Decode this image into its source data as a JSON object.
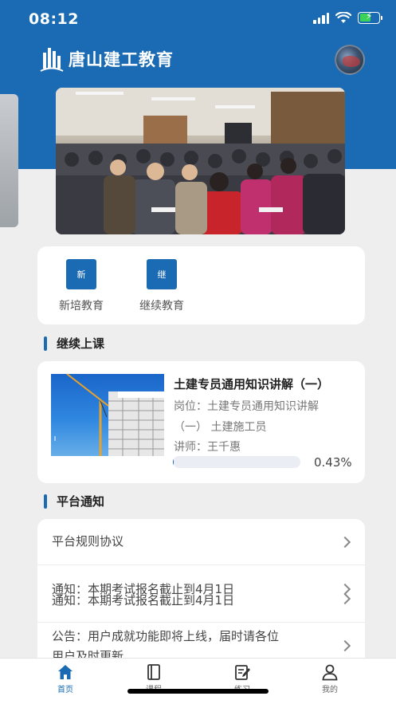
{
  "status_bar": {
    "time": "08:12"
  },
  "header": {
    "logo_text": "唐山建工教育"
  },
  "quick_menu": [
    {
      "icon_text": "新",
      "label": "新培教育"
    },
    {
      "icon_text": "继",
      "label": "继续教育"
    }
  ],
  "sections": {
    "continue_title": "继续上课",
    "notices_title": "平台通知"
  },
  "course": {
    "title": "土建专员通用知识讲解（一）",
    "position_line1": "岗位：土建专员通用知识讲解",
    "position_line2": "（一） 土建施工员",
    "teacher": "讲师：王千惠",
    "progress_text": "0.43%",
    "progress_fraction": 0.0043
  },
  "notices": [
    {
      "text": "平台规则协议"
    },
    {
      "text": "通知：本期考试报名截止到4月1日",
      "text_dup": "通知：本期考试报名截止到4月1日"
    },
    {
      "text": "公告：用户成就功能即将上线，届时请各位",
      "text2": "用户及时更新"
    }
  ],
  "tabbar": [
    {
      "label": "首页",
      "icon": "home-icon",
      "active": true
    },
    {
      "label": "课程",
      "icon": "book-icon",
      "active": false
    },
    {
      "label": "练习",
      "icon": "edit-icon",
      "active": false
    },
    {
      "label": "我的",
      "icon": "user-icon",
      "active": false
    }
  ],
  "colors": {
    "brand": "#1a6bb3",
    "background": "#eeeeee"
  }
}
